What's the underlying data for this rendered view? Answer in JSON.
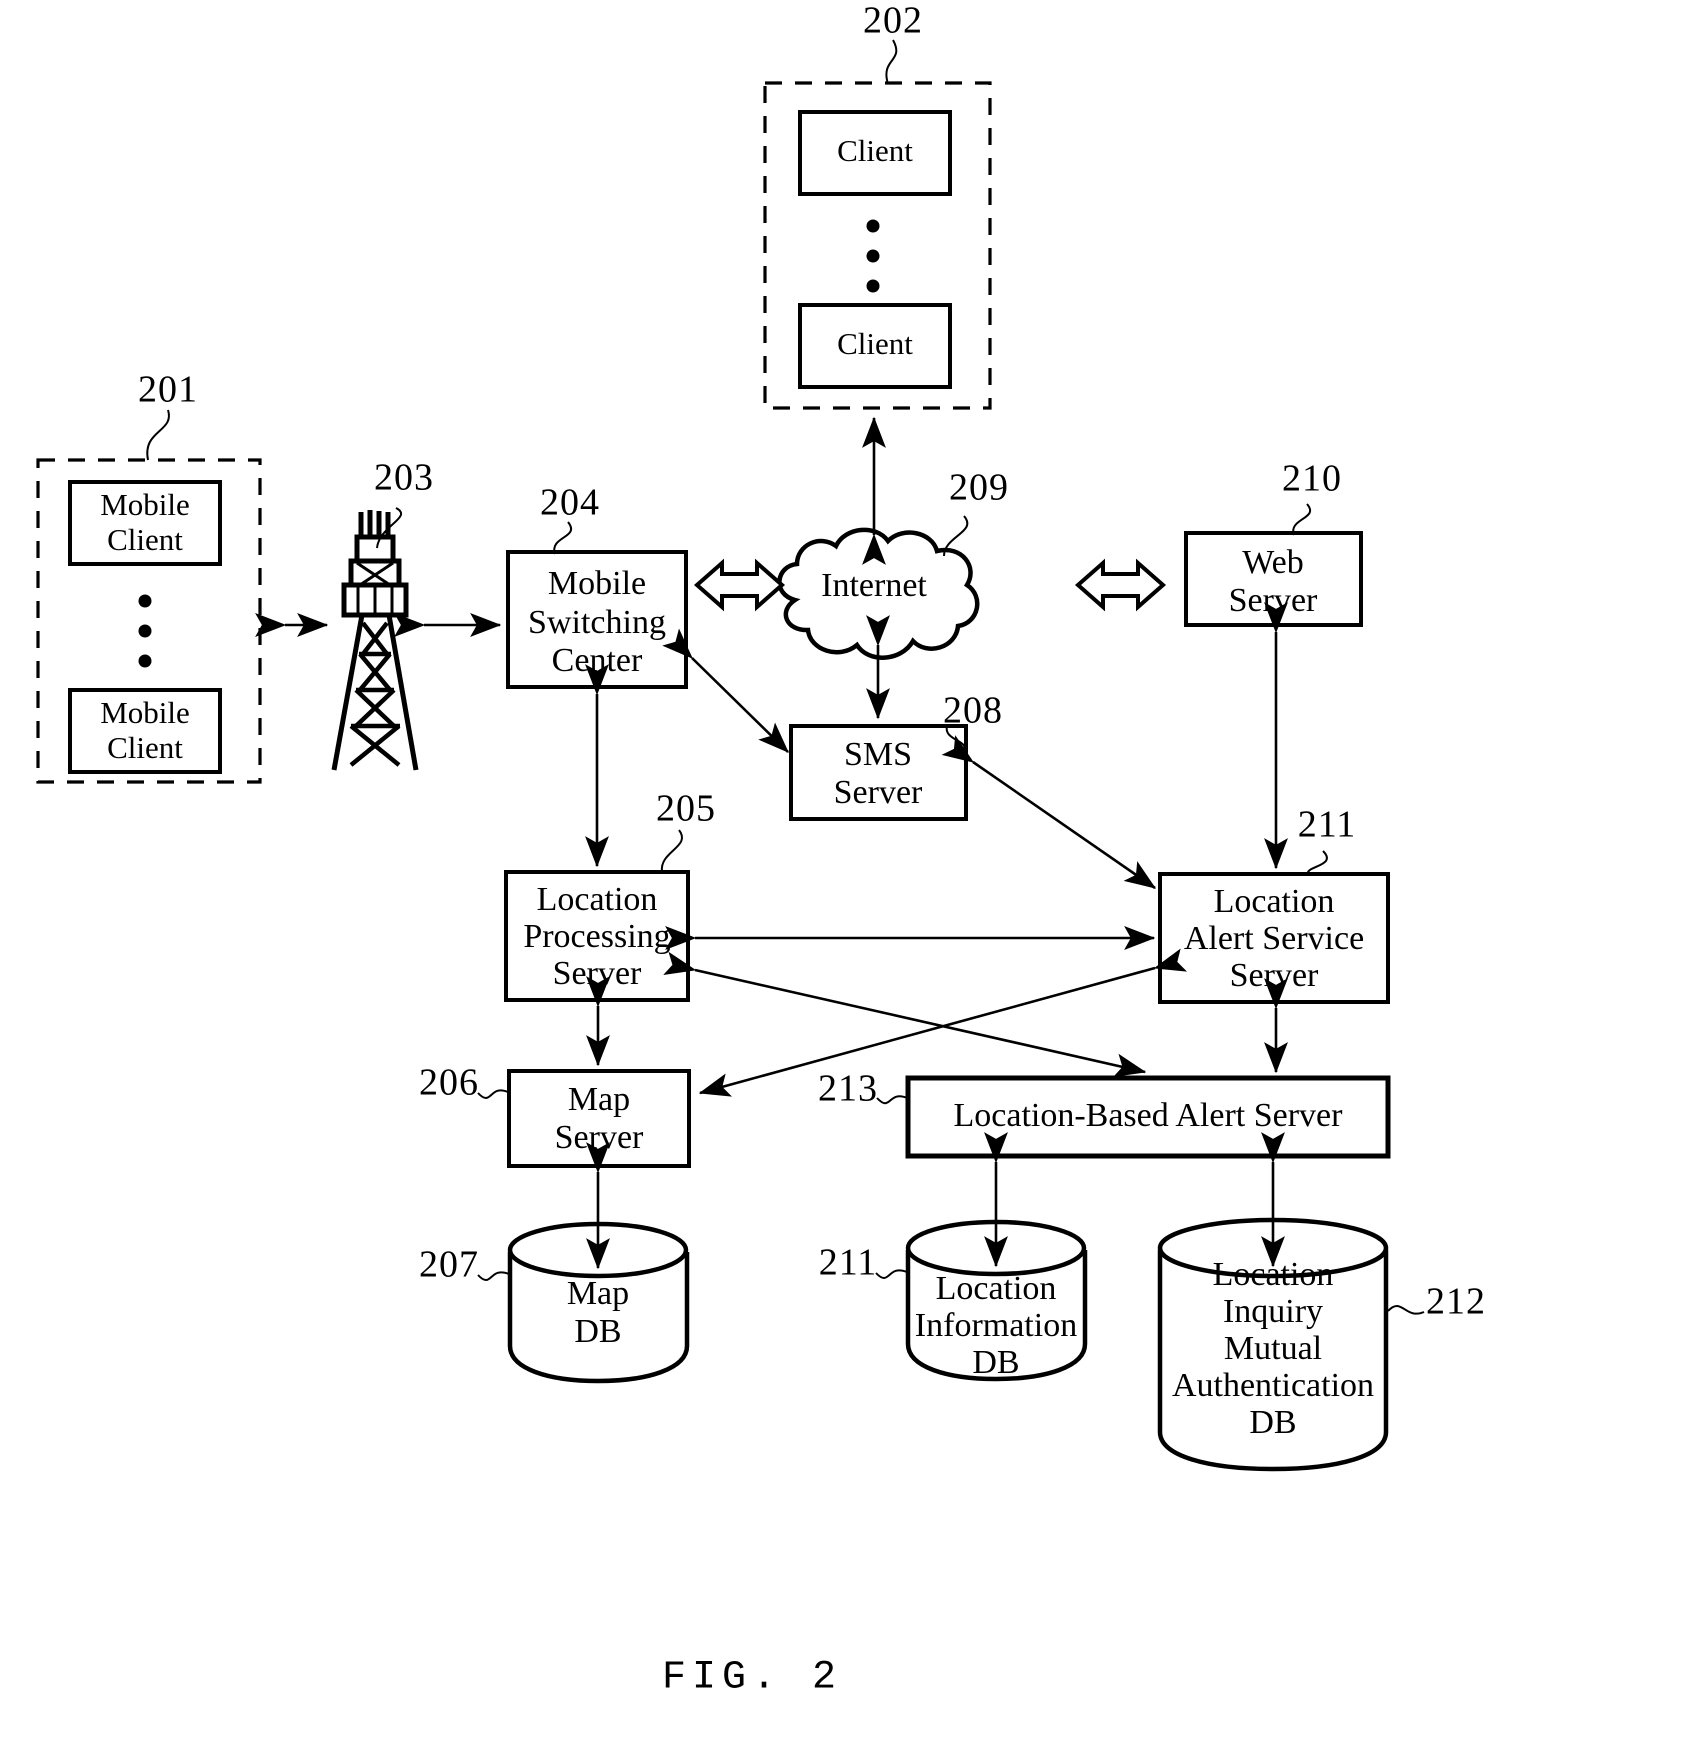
{
  "figure": {
    "caption": "FIG. 2",
    "title": "Location-based alert service system block diagram"
  },
  "groups": [
    {
      "id": "mobile-client-group",
      "ref": "201",
      "members": [
        "Mobile\nClient",
        "Mobile\nClient"
      ],
      "ellipsis": true
    },
    {
      "id": "client-group",
      "ref": "202",
      "members": [
        "Client",
        "Client"
      ],
      "ellipsis": true
    }
  ],
  "nodes": {
    "mobile_client_top": {
      "ref": "201",
      "line1": "Mobile",
      "line2": "Client"
    },
    "mobile_client_bottom": {
      "ref": "201",
      "line1": "Mobile",
      "line2": "Client"
    },
    "client_top": {
      "ref": "202",
      "line1": "Client"
    },
    "client_bottom": {
      "ref": "202",
      "line1": "Client"
    },
    "base_station": {
      "ref": "203",
      "label": "base-station-tower"
    },
    "mobile_switching_center": {
      "ref": "204",
      "line1": "Mobile",
      "line2": "Switching",
      "line3": "Center"
    },
    "location_processing_server": {
      "ref": "205",
      "line1": "Location",
      "line2": "Processing",
      "line3": "Server"
    },
    "map_server": {
      "ref": "206",
      "line1": "Map",
      "line2": "Server"
    },
    "map_db": {
      "ref": "207",
      "line1": "Map",
      "line2": "DB"
    },
    "sms_server": {
      "ref": "208",
      "line1": "SMS",
      "line2": "Server"
    },
    "internet": {
      "ref": "209",
      "line1": "Internet"
    },
    "web_server": {
      "ref": "210",
      "line1": "Web",
      "line2": "Server"
    },
    "location_alert_service_server": {
      "ref": "211",
      "line1": "Location",
      "line2": "Alert Service",
      "line3": "Server"
    },
    "location_information_db": {
      "ref": "211",
      "line1": "Location",
      "line2": "Information",
      "line3": "DB"
    },
    "location_inquiry_db": {
      "ref": "212",
      "line1": "Location",
      "line2": "Inquiry",
      "line3": "Mutual",
      "line4": "Authentication",
      "line5": "DB"
    },
    "location_based_alert_server": {
      "ref": "213",
      "line1": "Location-Based Alert Server"
    }
  },
  "reference_numerals": [
    {
      "num": "201",
      "target": "mobile-client-group"
    },
    {
      "num": "202",
      "target": "client-group"
    },
    {
      "num": "203",
      "target": "base-station-tower"
    },
    {
      "num": "204",
      "target": "mobile-switching-center"
    },
    {
      "num": "205",
      "target": "location-processing-server"
    },
    {
      "num": "206",
      "target": "map-server"
    },
    {
      "num": "207",
      "target": "map-db"
    },
    {
      "num": "208",
      "target": "sms-server"
    },
    {
      "num": "209",
      "target": "internet-cloud"
    },
    {
      "num": "210",
      "target": "web-server"
    },
    {
      "num": "211",
      "target": "location-alert-service-server"
    },
    {
      "num": "211",
      "target": "location-information-db"
    },
    {
      "num": "212",
      "target": "location-inquiry-mutual-authentication-db"
    },
    {
      "num": "213",
      "target": "location-based-alert-server"
    }
  ],
  "connections": [
    {
      "from": "mobile-client-group",
      "to": "base-station-tower",
      "style": "double-arrow-thin"
    },
    {
      "from": "base-station-tower",
      "to": "mobile-switching-center",
      "style": "double-arrow-thin"
    },
    {
      "from": "mobile-switching-center",
      "to": "internet-cloud",
      "style": "hollow-double-arrow"
    },
    {
      "from": "internet-cloud",
      "to": "client-group",
      "style": "double-arrow-thin"
    },
    {
      "from": "internet-cloud",
      "to": "sms-server",
      "style": "double-arrow-thin"
    },
    {
      "from": "internet-cloud",
      "to": "web-server",
      "style": "hollow-double-arrow"
    },
    {
      "from": "mobile-switching-center",
      "to": "sms-server",
      "style": "double-arrow-thin"
    },
    {
      "from": "mobile-switching-center",
      "to": "location-processing-server",
      "style": "double-arrow-thin"
    },
    {
      "from": "sms-server",
      "to": "location-alert-service-server",
      "style": "double-arrow-thin"
    },
    {
      "from": "web-server",
      "to": "location-alert-service-server",
      "style": "double-arrow-thin"
    },
    {
      "from": "location-processing-server",
      "to": "location-alert-service-server",
      "style": "double-arrow-thin"
    },
    {
      "from": "location-processing-server",
      "to": "location-based-alert-server",
      "style": "double-arrow-thin"
    },
    {
      "from": "location-alert-service-server",
      "to": "map-server",
      "style": "double-arrow-thin"
    },
    {
      "from": "location-processing-server",
      "to": "map-server",
      "style": "double-arrow-thin"
    },
    {
      "from": "map-server",
      "to": "map-db",
      "style": "double-arrow-thin"
    },
    {
      "from": "location-alert-service-server",
      "to": "location-based-alert-server",
      "style": "double-arrow-thin"
    },
    {
      "from": "location-based-alert-server",
      "to": "location-information-db",
      "style": "double-arrow-thin"
    },
    {
      "from": "location-based-alert-server",
      "to": "location-inquiry-mutual-authentication-db",
      "style": "double-arrow-thin"
    }
  ],
  "colors": {
    "stroke": "#000000",
    "background": "#ffffff"
  }
}
